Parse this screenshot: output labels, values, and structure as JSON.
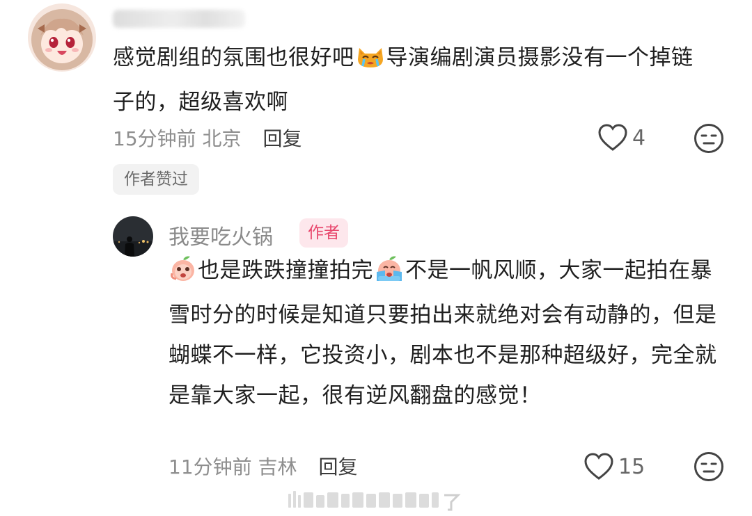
{
  "comment": {
    "text_before_emoji": "感觉剧组的氛围也很好吧",
    "emoji_name": "crying-cat-emoji",
    "text_after_emoji": "导演编剧演员摄影没有一个掉链子的，超级喜欢啊",
    "time": "15分钟前",
    "location": "北京",
    "reply_label": "回复",
    "like_count": "4",
    "author_liked_label": "作者赞过"
  },
  "reply": {
    "author_name": "我要吃火锅",
    "author_badge": "作者",
    "emoji1_name": "peach-thinking-emoji",
    "text_part1": "也是跌跌撞撞拍完",
    "emoji2_name": "peach-crying-emoji",
    "text_part2": "不是一帆风顺，大家一起拍在暴雪时分的时候是知道只要拍出来就绝对会有动静的，但是蝴蝶不一样，它投资小，剧本也不是那种超级好，完全就是靠大家一起，很有逆风翻盘的感觉！",
    "time": "11分钟前",
    "location": "吉林",
    "reply_label": "回复",
    "like_count": "15"
  },
  "colors": {
    "badge_bg": "#fde7ec",
    "badge_text": "#e8456b",
    "meta_gray": "#8e8e8e"
  }
}
